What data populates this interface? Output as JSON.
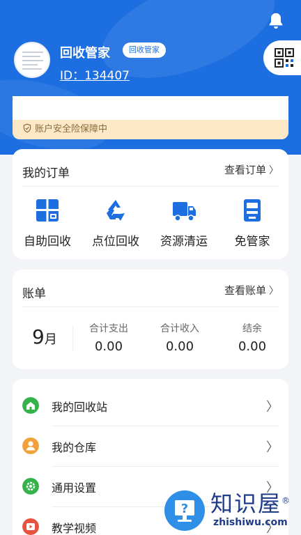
{
  "header": {
    "username": "回收管家",
    "role_badge": "回收管家",
    "user_id": "ID：134407",
    "security_notice": "账户安全险保障中"
  },
  "orders": {
    "title": "我的订单",
    "view_all": "查看订单",
    "items": [
      {
        "label": "自助回收",
        "icon": "self-recycle-icon"
      },
      {
        "label": "点位回收",
        "icon": "recycle-icon"
      },
      {
        "label": "资源清运",
        "icon": "truck-icon"
      },
      {
        "label": "免管家",
        "icon": "recycle-machine-icon"
      }
    ]
  },
  "bill": {
    "title": "账单",
    "view_all": "查看账单",
    "month_num": "9",
    "month_unit": "月",
    "columns": [
      {
        "label": "合计支出",
        "value": "0.00"
      },
      {
        "label": "合计收入",
        "value": "0.00"
      },
      {
        "label": "结余",
        "value": "0.00"
      }
    ]
  },
  "menu": {
    "items": [
      {
        "label": "我的回收站",
        "icon": "home-icon",
        "color": "#35b34a"
      },
      {
        "label": "我的仓库",
        "icon": "person-icon",
        "color": "#f0a13a"
      },
      {
        "label": "通用设置",
        "icon": "gear-icon",
        "color": "#35b34a"
      },
      {
        "label": "教学视频",
        "icon": "play-icon",
        "color": "#e8533f"
      }
    ]
  },
  "watermark": {
    "title": "知识屋",
    "subtitle": "zhishiwu.com",
    "registered": "®"
  },
  "colors": {
    "primary": "#1d6ee0",
    "notice_bg": "#fde9c8",
    "notice_text": "#8a6b3a"
  }
}
